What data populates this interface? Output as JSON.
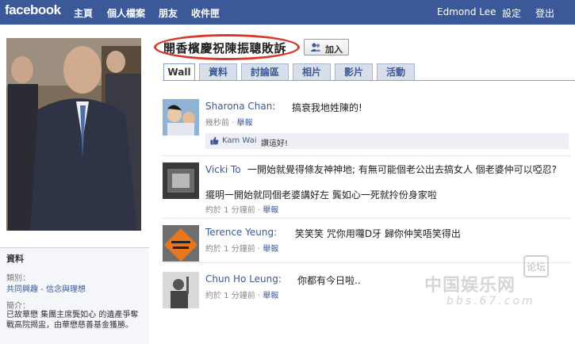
{
  "topbar": {
    "logo": "facebook",
    "nav": [
      "主頁",
      "個人檔案",
      "朋友",
      "收件匣"
    ],
    "user": "Edmond Lee",
    "settings": "設定",
    "logout": "登出"
  },
  "page": {
    "title": "開香檳慶祝陳振聰敗訴",
    "join_label": "加入",
    "tabs": [
      "Wall",
      "資料",
      "討論區",
      "相片",
      "影片",
      "活動"
    ]
  },
  "info": {
    "title": "資料",
    "category_label": "類別：",
    "category_value": "共同興趣 - 信念與理想",
    "desc_label": "簡介：",
    "desc_text": "已故華懋 集團主席龔如心 的遺產爭奪戰高院揭盅，由華懋慈善基金獲勝。"
  },
  "posts": [
    {
      "name": "Sharona Chan:",
      "text": "搞衰我地姓陳的!",
      "time": "幾秒前",
      "report": "舉報"
    },
    {
      "name": "Vicki To",
      "text": "一開始就覺得條友神神地; 有無可能個老公出去搞女人 個老婆仲可以啞忍?",
      "text2": "擺明一開始就同個老婆講好左 龔如心一死就拎份身家啦",
      "time": "約於 1 分鐘前",
      "report": "舉報"
    },
    {
      "name": "Terence Yeung:",
      "text": "笑笑笑 咒你用囖D牙 歸你仲笑唔笑得出",
      "time": "約於 1 分鐘前",
      "report": "舉報"
    },
    {
      "name": "Chun Ho Leung:",
      "text": "你都有今日啦..",
      "time": "約於 1 分鐘前",
      "report": "舉報"
    }
  ],
  "like": {
    "name": "Kam Wai",
    "text": "讚這好!"
  },
  "watermark": {
    "main": "中国娱乐网",
    "sub": "bbs.67.com",
    "box": "论坛"
  },
  "colors": {
    "brand": "#3b5998",
    "highlight": "#d63a2a"
  }
}
